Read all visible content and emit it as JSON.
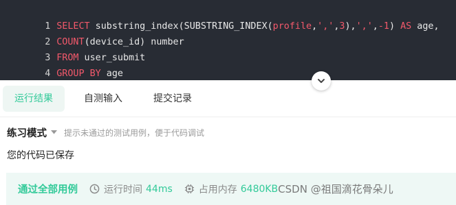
{
  "editor": {
    "lines": [
      {
        "num": "1",
        "tokens": [
          {
            "t": "SELECT",
            "c": "kw"
          },
          {
            "t": " substring_index(SUBSTRING_INDEX(",
            "c": "fn"
          },
          {
            "t": "profile",
            "c": "str"
          },
          {
            "t": ",",
            "c": "pl"
          },
          {
            "t": "','",
            "c": "str"
          },
          {
            "t": ",",
            "c": "pl"
          },
          {
            "t": "3",
            "c": "num"
          },
          {
            "t": "),",
            "c": "pl"
          },
          {
            "t": "','",
            "c": "str"
          },
          {
            "t": ",",
            "c": "pl"
          },
          {
            "t": "-1",
            "c": "num"
          },
          {
            "t": ") ",
            "c": "pl"
          },
          {
            "t": "AS",
            "c": "kw"
          },
          {
            "t": " age,",
            "c": "pl"
          }
        ]
      },
      {
        "num": "2",
        "tokens": [
          {
            "t": "COUNT",
            "c": "kw"
          },
          {
            "t": "(device_id) number",
            "c": "pl"
          }
        ]
      },
      {
        "num": "3",
        "tokens": [
          {
            "t": "FROM",
            "c": "kw"
          },
          {
            "t": " user_submit",
            "c": "pl"
          }
        ]
      },
      {
        "num": "4",
        "tokens": [
          {
            "t": "GROUP BY",
            "c": "kw"
          },
          {
            "t": " age",
            "c": "pl"
          }
        ]
      }
    ]
  },
  "tabs": [
    {
      "label": "运行结果",
      "active": true
    },
    {
      "label": "自测输入",
      "active": false
    },
    {
      "label": "提交记录",
      "active": false
    }
  ],
  "mode": {
    "title": "练习模式",
    "hint": "提示未通过的测试用例，便于代码调试"
  },
  "saved_message": "您的代码已保存",
  "result": {
    "status": "通过全部用例",
    "runtime_label": "运行时间",
    "runtime_value": "44ms",
    "memory_label": "占用内存",
    "memory_value": "6480KB"
  },
  "watermark": "CSDN @祖国滴花骨朵儿",
  "colors": {
    "accent": "#32ca99",
    "editor_bg": "#282c34",
    "keyword": "#f3596b"
  }
}
